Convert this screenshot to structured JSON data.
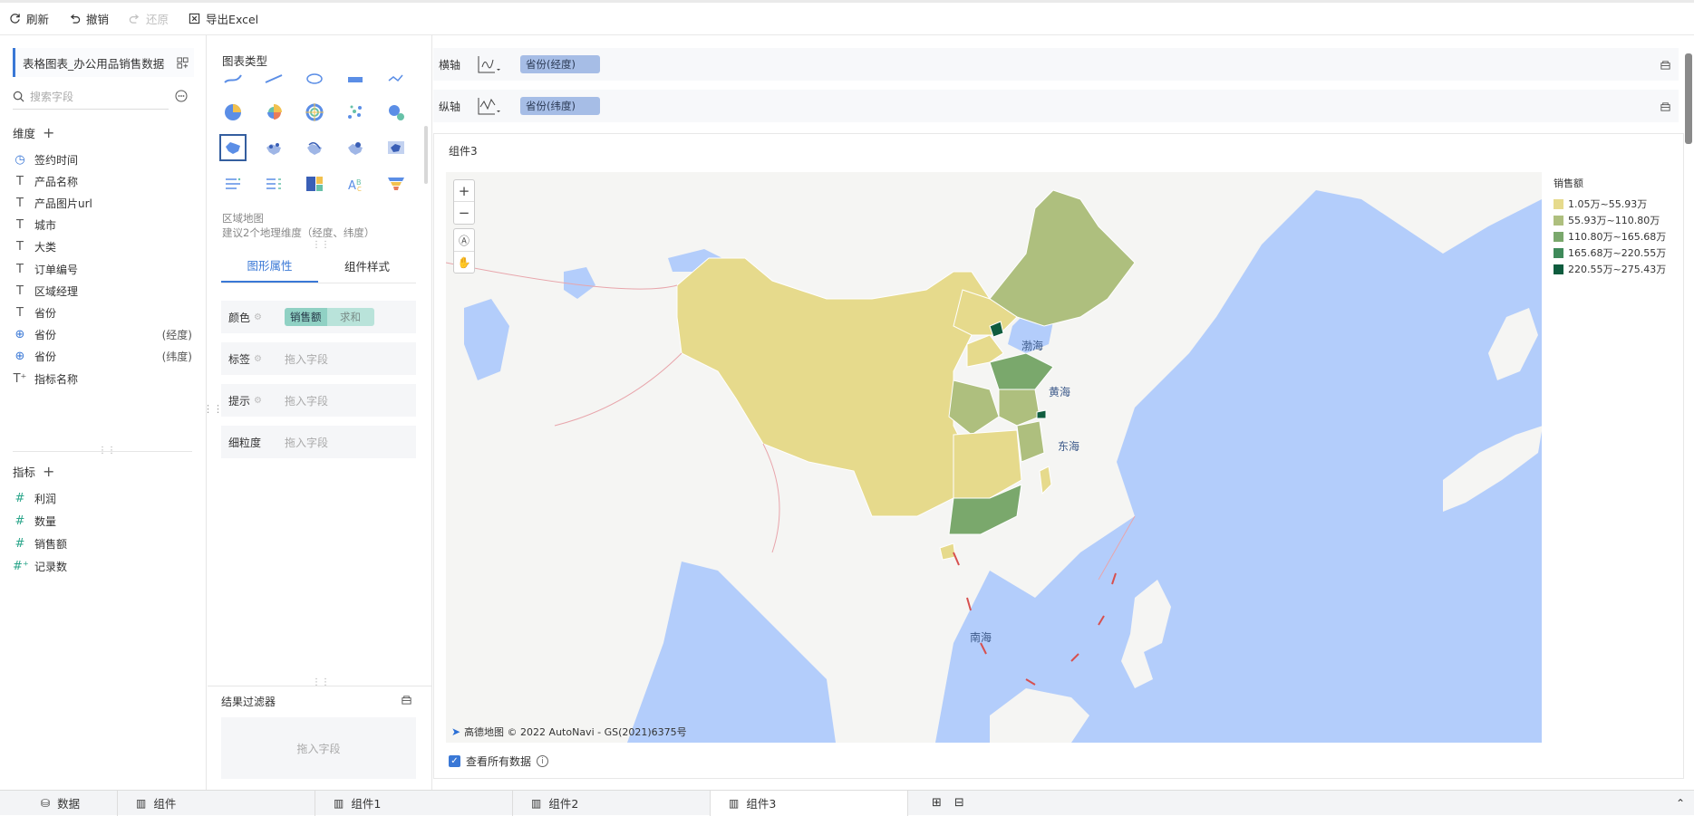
{
  "toolbar": {
    "refresh": "刷新",
    "undo": "撤销",
    "redo": "还原",
    "export": "导出Excel"
  },
  "left": {
    "dataset": "表格图表_办公用品销售数据",
    "search_placeholder": "搜索字段",
    "dimensions_title": "维度",
    "dimensions": [
      {
        "icon": "clock",
        "label": "签约时间",
        "suffix": ""
      },
      {
        "icon": "text",
        "label": "产品名称",
        "suffix": ""
      },
      {
        "icon": "text",
        "label": "产品图片url",
        "suffix": ""
      },
      {
        "icon": "text",
        "label": "城市",
        "suffix": ""
      },
      {
        "icon": "text",
        "label": "大类",
        "suffix": ""
      },
      {
        "icon": "text",
        "label": "订单编号",
        "suffix": ""
      },
      {
        "icon": "text",
        "label": "区域经理",
        "suffix": ""
      },
      {
        "icon": "text",
        "label": "省份",
        "suffix": ""
      },
      {
        "icon": "globe",
        "label": "省份",
        "suffix": "(经度)"
      },
      {
        "icon": "globe",
        "label": "省份",
        "suffix": "(纬度)"
      },
      {
        "icon": "text-plus",
        "label": "指标名称",
        "suffix": ""
      }
    ],
    "measures_title": "指标",
    "measures": [
      {
        "icon": "hash",
        "label": "利润"
      },
      {
        "icon": "hash",
        "label": "数量"
      },
      {
        "icon": "hash",
        "label": "销售额"
      },
      {
        "icon": "hash-plus",
        "label": "记录数"
      }
    ]
  },
  "mid": {
    "chart_type_title": "图表类型",
    "chart_desc_title": "区域地图",
    "chart_desc_hint": "建议2个地理维度（经度、纬度）",
    "tabs": [
      "图形属性",
      "组件样式"
    ],
    "props": [
      {
        "label": "颜色",
        "field": "销售额",
        "agg": "求和"
      },
      {
        "label": "标签",
        "placeholder": "拖入字段"
      },
      {
        "label": "提示",
        "placeholder": "拖入字段"
      },
      {
        "label": "细粒度",
        "placeholder": "拖入字段"
      }
    ],
    "filter_title": "结果过滤器",
    "filter_placeholder": "拖入字段"
  },
  "axes": {
    "x_label": "横轴",
    "x_field": "省份(经度)",
    "y_label": "纵轴",
    "y_field": "省份(纬度)"
  },
  "panel": {
    "title": "组件3",
    "map_labels": {
      "bohai": "渤海",
      "huanghai": "黄海",
      "donghai": "东海",
      "nanhai": "南海"
    },
    "attribution": "高德地图 © 2022 AutoNavi - GS(2021)6375号",
    "legend_title": "销售额",
    "legend": [
      {
        "label": "1.05万~55.93万",
        "color": "#e6da8c"
      },
      {
        "label": "55.93万~110.80万",
        "color": "#aebf7e"
      },
      {
        "label": "110.80万~165.68万",
        "color": "#7aa86c"
      },
      {
        "label": "165.68万~220.55万",
        "color": "#3f8a5a"
      },
      {
        "label": "220.55万~275.43万",
        "color": "#0f5c3e"
      }
    ],
    "view_all": "查看所有数据"
  },
  "bottom_tabs": [
    "数据",
    "组件",
    "组件1",
    "组件2",
    "组件3"
  ],
  "colors": {
    "accent": "#3a78d6",
    "water": "#b3cdfb",
    "land": "#f5f5f3"
  }
}
